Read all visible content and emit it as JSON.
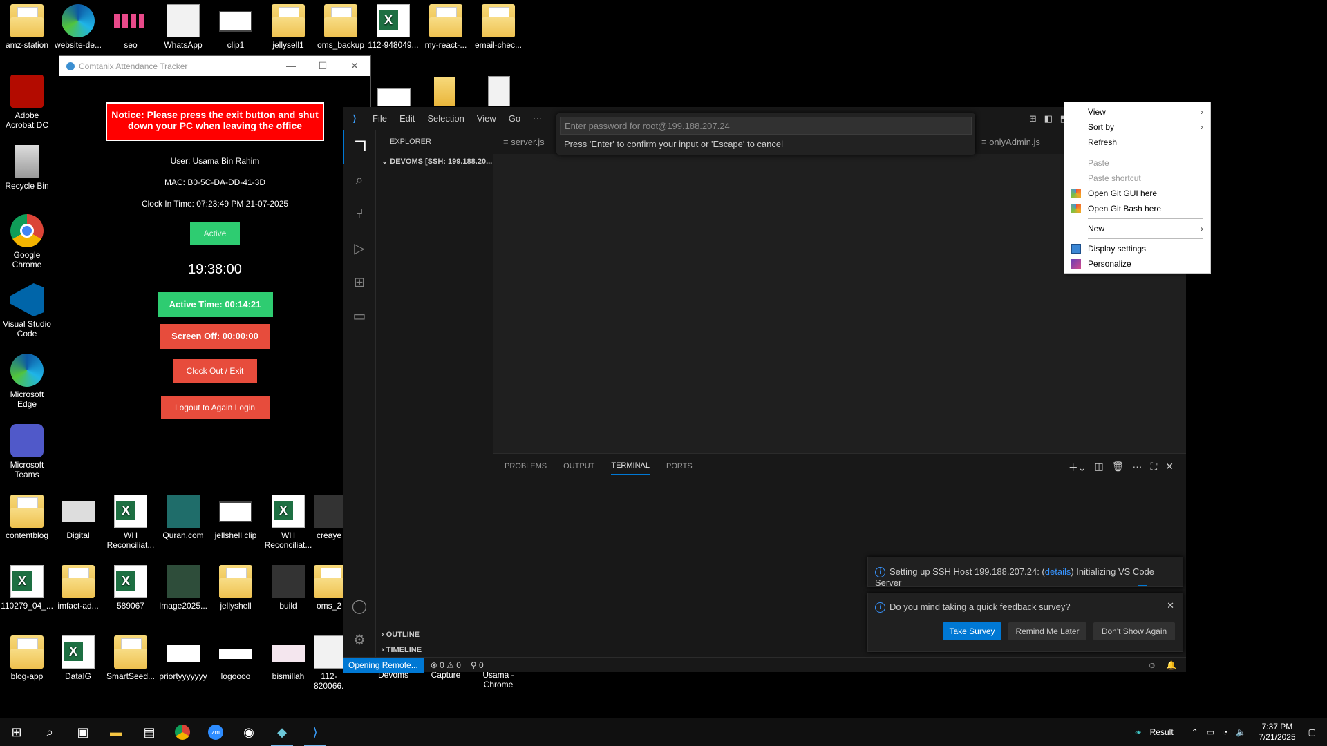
{
  "desktop": {
    "icons": {
      "amz": "amz-station",
      "website": "website-de...",
      "seo": "seo",
      "whatsapp": "WhatsApp",
      "clip1": "clip1",
      "jellysell1": "jellysell1",
      "oms_backup": "oms_backup",
      "xls112": "112-948049...",
      "myreact": "my-react-...",
      "email": "email-chec...",
      "acrobat": "Adobe Acrobat DC",
      "recycle": "Recycle Bin",
      "chrome": "Google Chrome",
      "vscode": "Visual Studio Code",
      "edge": "Microsoft Edge",
      "teams": "Microsoft Teams",
      "contentblog": "contentblog",
      "digital": "Digital",
      "whrec1": "WH Reconciliat...",
      "quran": "Quran.com",
      "jellshell": "jellshell clip",
      "whrec2": "WH Reconciliat...",
      "creaye": "creaye",
      "x110279": "110279_04_...",
      "imfact": "imfact-ad...",
      "x589067": "589067",
      "image2025": "Image2025...",
      "jellyshell": "jellyshell",
      "build": "build",
      "oms2": "oms_2",
      "blogapp": "blog-app",
      "datalg": "DataIG",
      "smartseed": "SmartSeed...",
      "priorty": "priortyyyyyyy",
      "logoooo": "logoooo",
      "bismillah": "bismillah",
      "x112820": "112-820066...",
      "devoms": "Devoms",
      "capture": "Capture",
      "usama": "Usama - Chrome"
    }
  },
  "attendance": {
    "title": "Comtanix Attendance Tracker",
    "notice": "Notice: Please press the exit button and shut down your PC when leaving the office",
    "user": "User: Usama Bin Rahim",
    "mac": "MAC: B0-5C-DA-DD-41-3D",
    "clock_in": "Clock In Time: 07:23:49 PM 21-07-2025",
    "status": "Active",
    "clock": "19:38:00",
    "active_time": "Active Time: 00:14:21",
    "screen_off": "Screen Off: 00:00:00",
    "clock_out": "Clock Out / Exit",
    "logout": "Logout to Again Login",
    "colors": {
      "notice": "#ff0000",
      "green": "#2ecc71",
      "red": "#e74c3c"
    }
  },
  "vscode": {
    "menu": [
      "File",
      "Edit",
      "Selection",
      "View",
      "Go",
      "···"
    ],
    "explorer_header": "EXPLORER",
    "root_folder": "DEVOMS [SSH: 199.188.20...",
    "outline": "OUTLINE",
    "timeline": "TIMELINE",
    "tabs": {
      "server": "server.js",
      "onlyadmin": "onlyAdmin.js"
    },
    "quickpick": {
      "placeholder": "Enter password for root@199.188.207.24",
      "hint": "Press 'Enter' to confirm your input or 'Escape' to cancel"
    },
    "panel_tabs": {
      "problems": "PROBLEMS",
      "output": "OUTPUT",
      "terminal": "TERMINAL",
      "ports": "PORTS"
    },
    "notification_ssh": {
      "prefix": "Setting up SSH Host 199.188.207.24: (",
      "link": "details",
      "suffix": ") Initializing VS Code Server"
    },
    "notification_survey": {
      "text": "Do you mind taking a quick feedback survey?",
      "take": "Take Survey",
      "remind": "Remind Me Later",
      "dont": "Don't Show Again"
    },
    "status": {
      "remote": "Opening Remote...",
      "problems": "⊗ 0 ⚠ 0",
      "ports": "⚲ 0"
    },
    "accent": "#0078d4"
  },
  "context_menu": {
    "view": "View",
    "sort_by": "Sort by",
    "refresh": "Refresh",
    "paste": "Paste",
    "paste_shortcut": "Paste shortcut",
    "git_gui": "Open Git GUI here",
    "git_bash": "Open Git Bash here",
    "new": "New",
    "display": "Display settings",
    "personalize": "Personalize"
  },
  "taskbar": {
    "result": "Result",
    "time": "7:37 PM",
    "date": "7/21/2025"
  }
}
